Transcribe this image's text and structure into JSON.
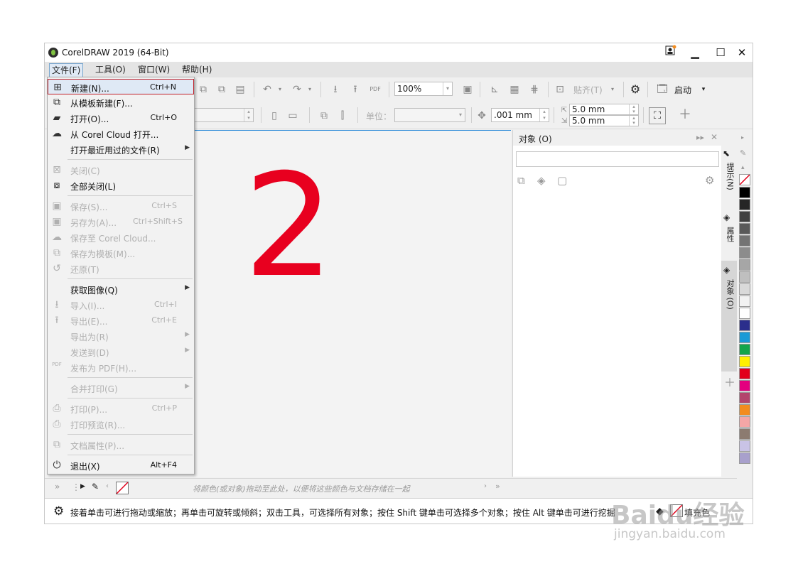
{
  "window": {
    "title": "CorelDRAW 2019 (64-Bit)",
    "buttons": {
      "minimize": "▁",
      "maximize": "☐",
      "close": "✕"
    }
  },
  "menubar": {
    "file": "文件(F)",
    "tools": "工具(O)",
    "window": "窗口(W)",
    "help": "帮助(H)"
  },
  "toolbar": {
    "zoom": "100%",
    "snap_label": "贴齐(T)",
    "launch_label": "启动",
    "units_label": "单位：",
    "nudge": ".001 mm",
    "dup_x": "5.0 mm",
    "dup_y": "5.0 mm"
  },
  "canvas": {
    "annotation": "2"
  },
  "docker": {
    "title": "对象 (O)"
  },
  "side_tabs": {
    "hints": "提示(N)",
    "properties": "属性",
    "objects": "对象 (O)"
  },
  "palette": {
    "colors": [
      "#000000",
      "#262626",
      "#404040",
      "#595959",
      "#737373",
      "#8c8c8c",
      "#a6a6a6",
      "#bfbfbf",
      "#d9d9d9",
      "#f2f2f2",
      "#ffffff",
      "#2b2e8c",
      "#1a9ad6",
      "#13a54a",
      "#fff100",
      "#e2001a",
      "#e4007f",
      "#b3446c",
      "#f28c1f",
      "#f4a6a6",
      "#8c7b70",
      "#c9c3e6",
      "#a8a0cc"
    ]
  },
  "palette_bar": {
    "hint": "将颜色(或对象)拖动至此处，以便将这些颜色与文档存储在一起"
  },
  "statusbar": {
    "text": "接着单击可进行拖动或缩放；再单击可旋转或倾斜；双击工具，可选择所有对象；按住 Shift 键单击可选择多个对象；按住 Alt 键单击可进行挖掘",
    "fill_label": "填充色"
  },
  "file_menu": {
    "items": [
      {
        "label": "新建(N)...",
        "shortcut": "Ctrl+N",
        "icon": "new-doc-icon"
      },
      {
        "label": "从模板新建(F)...",
        "shortcut": "",
        "icon": "template-icon"
      },
      {
        "label": "打开(O)...",
        "shortcut": "Ctrl+O",
        "icon": "folder-icon"
      },
      {
        "label": "从 Corel Cloud 打开...",
        "shortcut": "",
        "icon": "cloud-download-icon"
      },
      {
        "label": "打开最近用过的文件(R)",
        "shortcut": "",
        "icon": ""
      },
      {
        "label": "关闭(C)",
        "shortcut": "",
        "icon": "close-doc-icon"
      },
      {
        "label": "全部关闭(L)",
        "shortcut": "",
        "icon": "close-all-icon"
      },
      {
        "label": "保存(S)...",
        "shortcut": "Ctrl+S",
        "icon": "save-icon"
      },
      {
        "label": "另存为(A)...",
        "shortcut": "Ctrl+Shift+S",
        "icon": "save-as-icon"
      },
      {
        "label": "保存至 Corel Cloud...",
        "shortcut": "",
        "icon": "cloud-upload-icon"
      },
      {
        "label": "保存为模板(M)...",
        "shortcut": "",
        "icon": "save-template-icon"
      },
      {
        "label": "还原(T)",
        "shortcut": "",
        "icon": "revert-icon"
      },
      {
        "label": "获取图像(Q)",
        "shortcut": "",
        "icon": ""
      },
      {
        "label": "导入(I)...",
        "shortcut": "Ctrl+I",
        "icon": "import-icon"
      },
      {
        "label": "导出(E)...",
        "shortcut": "Ctrl+E",
        "icon": "export-icon"
      },
      {
        "label": "导出为(R)",
        "shortcut": "",
        "icon": ""
      },
      {
        "label": "发送到(D)",
        "shortcut": "",
        "icon": ""
      },
      {
        "label": "发布为 PDF(H)...",
        "shortcut": "",
        "icon": "pdf-icon"
      },
      {
        "label": "合并打印(G)",
        "shortcut": "",
        "icon": ""
      },
      {
        "label": "打印(P)...",
        "shortcut": "Ctrl+P",
        "icon": "print-icon"
      },
      {
        "label": "打印预览(R)...",
        "shortcut": "",
        "icon": "print-preview-icon"
      },
      {
        "label": "文档属性(P)...",
        "shortcut": "",
        "icon": "doc-properties-icon"
      },
      {
        "label": "退出(X)",
        "shortcut": "Alt+F4",
        "icon": "power-icon"
      }
    ]
  },
  "watermark": {
    "text": "Baidu经验",
    "url": "jingyan.baidu.com"
  }
}
